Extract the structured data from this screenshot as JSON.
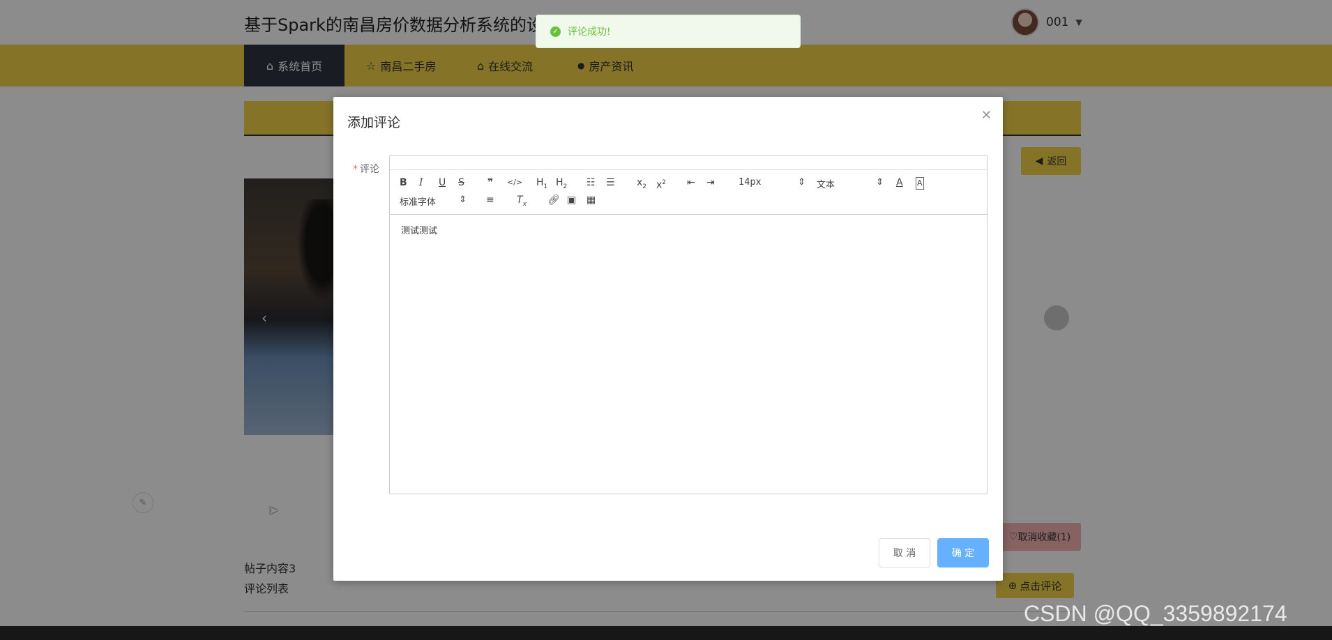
{
  "site": {
    "title": "基于Spark的南昌房价数据分析系统的设",
    "user_name": "001"
  },
  "nav": [
    {
      "icon": "home-icon",
      "glyph": "⌂",
      "label": "系统首页",
      "active": true
    },
    {
      "icon": "star-icon",
      "glyph": "☆",
      "label": "南昌二手房",
      "active": false
    },
    {
      "icon": "lock-icon",
      "glyph": "⌂",
      "label": "在线交流",
      "active": false
    },
    {
      "icon": "info-icon",
      "glyph": "●",
      "label": "房产资讯",
      "active": false
    }
  ],
  "page": {
    "back_label": "返回",
    "cancel_favorite_label": "取消收藏(1)",
    "post_content": "帖子内容3",
    "comment_list_label": "评论列表",
    "click_comment_label": "点击评论"
  },
  "modal": {
    "title": "添加评论",
    "field_label": "评论",
    "editor_content": "测试测试",
    "cancel_label": "取 消",
    "confirm_label": "确 定"
  },
  "toolbar": {
    "font_size": "14px",
    "header": "文本",
    "font_family": "标准字体"
  },
  "toast": {
    "message": "评论成功!"
  },
  "watermark": "CSDN @QQ_3359892174",
  "colors": {
    "accent_yellow": "#f3d34a",
    "nav_active": "#2e3440",
    "confirm_blue": "#66b1ff",
    "success_green": "#67c23a"
  }
}
